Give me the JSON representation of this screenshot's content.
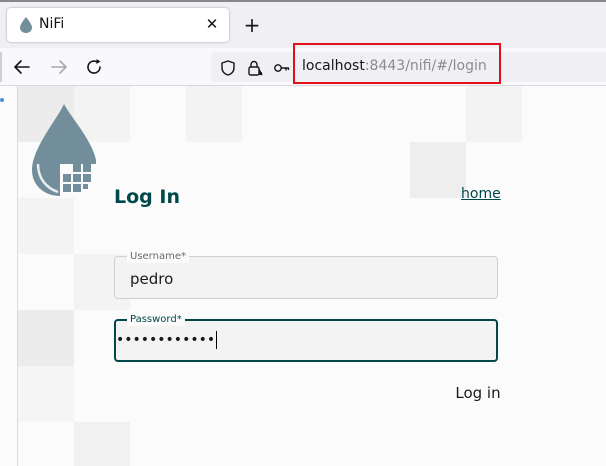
{
  "browser": {
    "tab": {
      "title": "NiFi",
      "close_glyph": "✕",
      "favicon": "nifi-drop-icon"
    },
    "new_tab_glyph": "+",
    "nav": {
      "back_icon": "back-arrow-icon",
      "forward_icon": "forward-arrow-icon",
      "reload_icon": "reload-icon"
    },
    "url": {
      "host": "localhost",
      "rest": ":8443/nifi/#/login",
      "icons": [
        "tracking-shield-icon",
        "lock-slash-icon",
        "key-icon"
      ]
    },
    "highlight_color": "#e0101a"
  },
  "page": {
    "title": "Log In",
    "home_link": "home",
    "username": {
      "label": "Username*",
      "value": "pedro"
    },
    "password": {
      "label": "Password*",
      "value": "••••••••••••"
    },
    "login_button": "Log in",
    "colors": {
      "accent": "#004849",
      "logo": "#728e9b",
      "tile": "#eeeeee"
    }
  }
}
